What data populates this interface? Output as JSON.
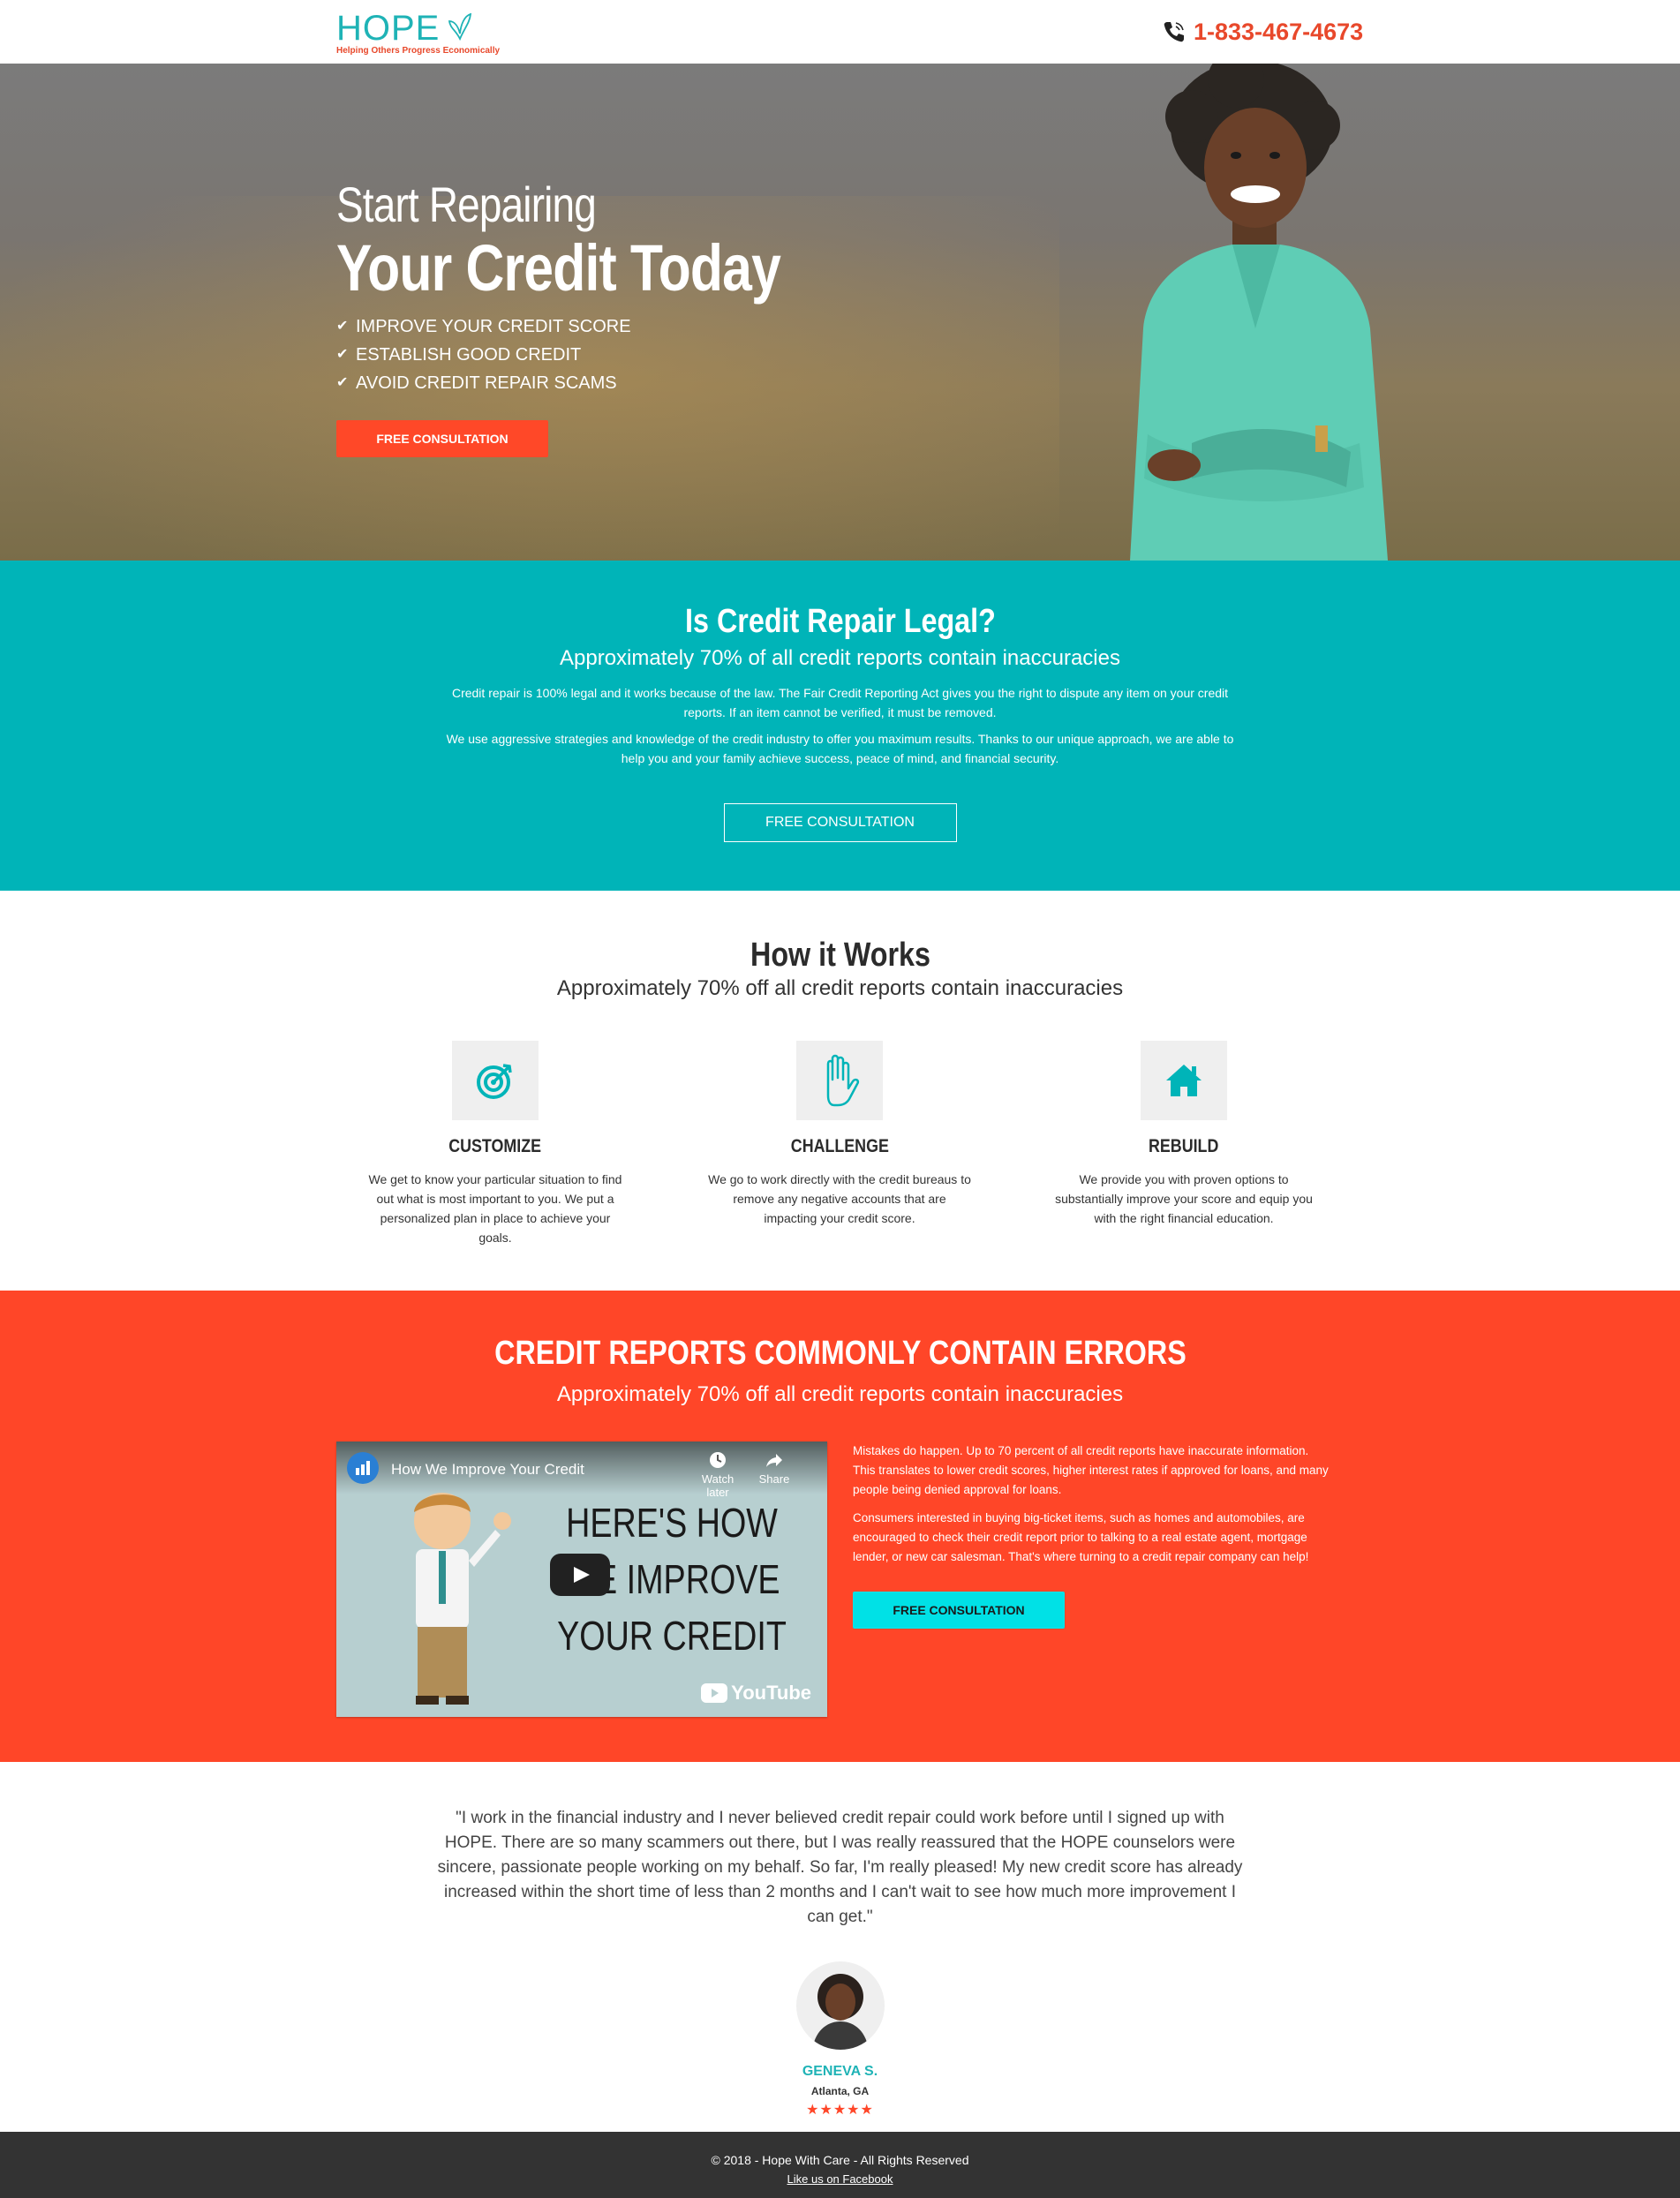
{
  "header": {
    "logo_word": "HOPE",
    "logo_tagline": "Helping Others Progress Economically",
    "phone": "1-833-467-4673"
  },
  "hero": {
    "title_line1": "Start Repairing",
    "title_line2": "Your Credit Today",
    "bullets": [
      "IMPROVE YOUR CREDIT SCORE",
      "ESTABLISH GOOD CREDIT",
      "AVOID CREDIT REPAIR SCAMS"
    ],
    "cta_label": "FREE CONSULTATION"
  },
  "legal": {
    "title": "Is Credit Repair Legal?",
    "subtitle": "Approximately 70% of all credit reports contain inaccuracies",
    "para1": "Credit repair is 100% legal and it works because of the law. The Fair Credit Reporting Act gives you the right to dispute any item on your credit reports. If an item cannot be verified, it must be removed.",
    "para2": "We use aggressive strategies and knowledge of the credit industry to offer you maximum results. Thanks to our unique approach, we are able to help you and your family achieve success, peace of mind, and financial security.",
    "cta_label": "FREE CONSULTATION"
  },
  "how": {
    "title": "How it Works",
    "subtitle": "Approximately 70% off all credit reports contain inaccuracies",
    "steps": [
      {
        "title": "CUSTOMIZE",
        "text": "We get to know your particular situation to find out what is most important to you. We put a personalized plan in place to achieve your goals.",
        "icon": "target-icon"
      },
      {
        "title": "CHALLENGE",
        "text": "We go to work directly with the credit bureaus to remove any negative accounts that are impacting your credit score.",
        "icon": "hand-icon"
      },
      {
        "title": "REBUILD",
        "text": "We provide you with proven options to substantially improve your score and equip you with the right financial education.",
        "icon": "house-icon"
      }
    ]
  },
  "errors": {
    "title": "CREDIT REPORTS COMMONLY CONTAIN ERRORS",
    "subtitle": "Approximately 70% off all credit reports contain inaccuracies",
    "video": {
      "title": "How We Improve Your Credit",
      "watch_later": "Watch later",
      "share": "Share",
      "headline": "HERE'S HOW WE IMPROVE YOUR CREDIT",
      "platform": "YouTube"
    },
    "para1": "Mistakes do happen. Up to 70 percent of all credit reports have inaccurate information. This translates to lower credit scores, higher interest rates if approved for loans, and many people being denied approval for loans.",
    "para2": "Consumers interested in buying big-ticket items, such as homes and automobiles, are encouraged to check their credit report prior to talking to a real estate agent, mortgage lender, or new car salesman. That's where turning to a credit repair company can help!",
    "cta_label": "FREE CONSULTATION"
  },
  "testimonial": {
    "quote": "\"I work in the financial industry and I never believed credit repair could work before until I signed up with HOPE. There are so many scammers out there, but I was really reassured that the HOPE counselors were sincere, passionate people working on my behalf. So far, I'm really pleased! My new credit score has already increased within the short time of less than 2 months and I can't wait to see how much more improvement I can get.\"",
    "name": "GENEVA S.",
    "location": "Atlanta, GA",
    "stars": "★★★★★",
    "rating": 5
  },
  "footer": {
    "copyright": "© 2018 - Hope With Care - All Rights Reserved",
    "facebook_link": "Like us on Facebook"
  },
  "colors": {
    "teal": "#00b4b8",
    "orange": "#ff4628",
    "cyan_button": "#00e1e6",
    "footer": "#333333"
  }
}
